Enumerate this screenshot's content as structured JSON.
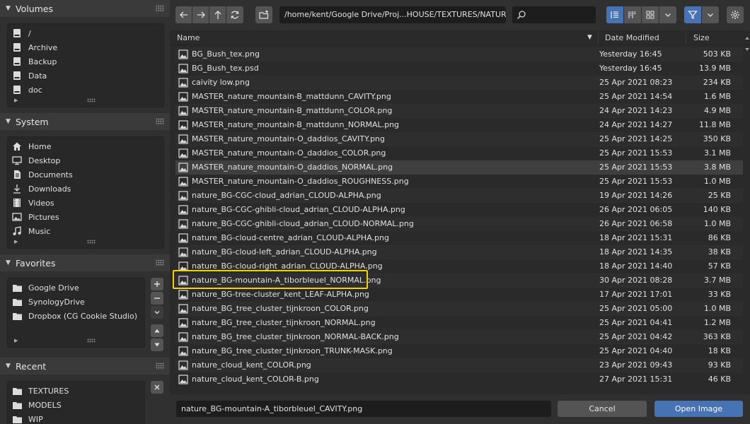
{
  "sidebar": {
    "volumes": {
      "title": "Volumes",
      "items": [
        {
          "label": "/",
          "icon": "disk-icon"
        },
        {
          "label": "Archive",
          "icon": "disk-icon"
        },
        {
          "label": "Backup",
          "icon": "disk-icon"
        },
        {
          "label": "Data",
          "icon": "disk-icon"
        },
        {
          "label": "doc",
          "icon": "disk-icon"
        }
      ]
    },
    "system": {
      "title": "System",
      "items": [
        {
          "label": "Home",
          "icon": "home-icon"
        },
        {
          "label": "Desktop",
          "icon": "desktop-icon"
        },
        {
          "label": "Documents",
          "icon": "documents-icon"
        },
        {
          "label": "Downloads",
          "icon": "downloads-icon"
        },
        {
          "label": "Videos",
          "icon": "videos-icon"
        },
        {
          "label": "Pictures",
          "icon": "pictures-icon"
        },
        {
          "label": "Music",
          "icon": "music-icon"
        }
      ]
    },
    "favorites": {
      "title": "Favorites",
      "items": [
        {
          "label": "Google Drive",
          "icon": "folder-icon"
        },
        {
          "label": "SynologyDrive",
          "icon": "folder-icon"
        },
        {
          "label": "Dropbox (CG Cookie Studio)",
          "icon": "folder-icon"
        }
      ]
    },
    "recent": {
      "title": "Recent",
      "items": [
        {
          "label": "TEXTURES",
          "icon": "folder-icon"
        },
        {
          "label": "MODELS",
          "icon": "folder-icon"
        },
        {
          "label": "WIP",
          "icon": "folder-icon"
        }
      ]
    }
  },
  "toolbar": {
    "path": "/home/kent/Google Drive/Proj...HOUSE/TEXTURES/NATURE/BG/",
    "search_value": ""
  },
  "columns": {
    "name": "Name",
    "date": "Date Modified",
    "size": "Size"
  },
  "files": [
    {
      "name": "BG_Bush_tex.png",
      "date": "Yesterday 16:45",
      "size": "503 KB"
    },
    {
      "name": "BG_Bush_tex.psd",
      "date": "Yesterday 16:45",
      "size": "13.9 MB"
    },
    {
      "name": "caivity low.png",
      "date": "25 Apr 2021 08:23",
      "size": "234 KB"
    },
    {
      "name": "MASTER_nature_mountain-B_mattdunn_CAVITY.png",
      "date": "25 Apr 2021 14:54",
      "size": "1.6 MB"
    },
    {
      "name": "MASTER_nature_mountain-B_mattdunn_COLOR.png",
      "date": "24 Apr 2021 14:23",
      "size": "4.9 MB"
    },
    {
      "name": "MASTER_nature_mountain-B_mattdunn_NORMAL.png",
      "date": "24 Apr 2021 14:27",
      "size": "11.8 MB"
    },
    {
      "name": "MASTER_nature_mountain-O_daddios_CAVITY.png",
      "date": "25 Apr 2021 14:25",
      "size": "350 KB"
    },
    {
      "name": "MASTER_nature_mountain-O_daddios_COLOR.png",
      "date": "25 Apr 2021 15:53",
      "size": "3.1 MB"
    },
    {
      "name": "MASTER_nature_mountain-O_daddios_NORMAL.png",
      "date": "25 Apr 2021 15:53",
      "size": "3.8 MB"
    },
    {
      "name": "MASTER_nature_mountain-O_daddios_ROUGHNESS.png",
      "date": "25 Apr 2021 15:53",
      "size": "1.0 MB"
    },
    {
      "name": "nature_BG-CGC-cloud_adrian_CLOUD-ALPHA.png",
      "date": "19 Apr 2021 14:26",
      "size": "25 KB"
    },
    {
      "name": "nature_BG-CGC-ghibli-cloud_adrian_CLOUD-ALPHA.png",
      "date": "26 Apr 2021 06:05",
      "size": "140 KB"
    },
    {
      "name": "nature_BG-CGC-ghibli-cloud_adrian_CLOUD-NORMAL.png",
      "date": "26 Apr 2021 06:58",
      "size": "1.0 MB"
    },
    {
      "name": "nature_BG-cloud-centre_adrian_CLOUD-ALPHA.png",
      "date": "18 Apr 2021 15:31",
      "size": "86 KB"
    },
    {
      "name": "nature_BG-cloud-left_adrian_CLOUD-ALPHA.png",
      "date": "18 Apr 2021 14:35",
      "size": "38 KB"
    },
    {
      "name": "nature_BG-cloud-right_adrian_CLOUD-ALPHA.png",
      "date": "18 Apr 2021 14:40",
      "size": "57 KB"
    },
    {
      "name": "nature_BG-mountain-A_tiborbleuel_NORMAL.png",
      "date": "30 Apr 2021 08:28",
      "size": "3.7 MB"
    },
    {
      "name": "nature_BG-tree-cluster_kent_LEAF-ALPHA.png",
      "date": "17 Apr 2021 17:01",
      "size": "33 KB"
    },
    {
      "name": "nature_BG_tree_cluster_tijnkroon_COLOR.png",
      "date": "25 Apr 2021 05:00",
      "size": "1.0 MB"
    },
    {
      "name": "nature_BG_tree_cluster_tijnkroon_NORMAL.png",
      "date": "25 Apr 2021 04:41",
      "size": "1.2 MB"
    },
    {
      "name": "nature_BG_tree_cluster_tijnkroon_NORMAL-BACK.png",
      "date": "25 Apr 2021 04:42",
      "size": "363 KB"
    },
    {
      "name": "nature_BG_tree_cluster_tijnkroon_TRUNK-MASK.png",
      "date": "25 Apr 2021 04:40",
      "size": "18 KB"
    },
    {
      "name": "nature_cloud_kent_COLOR.png",
      "date": "23 Apr 2021 09:43",
      "size": "93 KB"
    },
    {
      "name": "nature_cloud_kent_COLOR-B.png",
      "date": "27 Apr 2021 15:31",
      "size": "46 KB"
    }
  ],
  "footer": {
    "filename": "nature_BG-mountain-A_tiborbleuel_CAVITY.png",
    "cancel_label": "Cancel",
    "open_label": "Open Image"
  },
  "colors": {
    "accent": "#4772b3",
    "callout": "#f4d100",
    "panel_bg": "#303030",
    "list_bg": "#2a2a2a"
  }
}
